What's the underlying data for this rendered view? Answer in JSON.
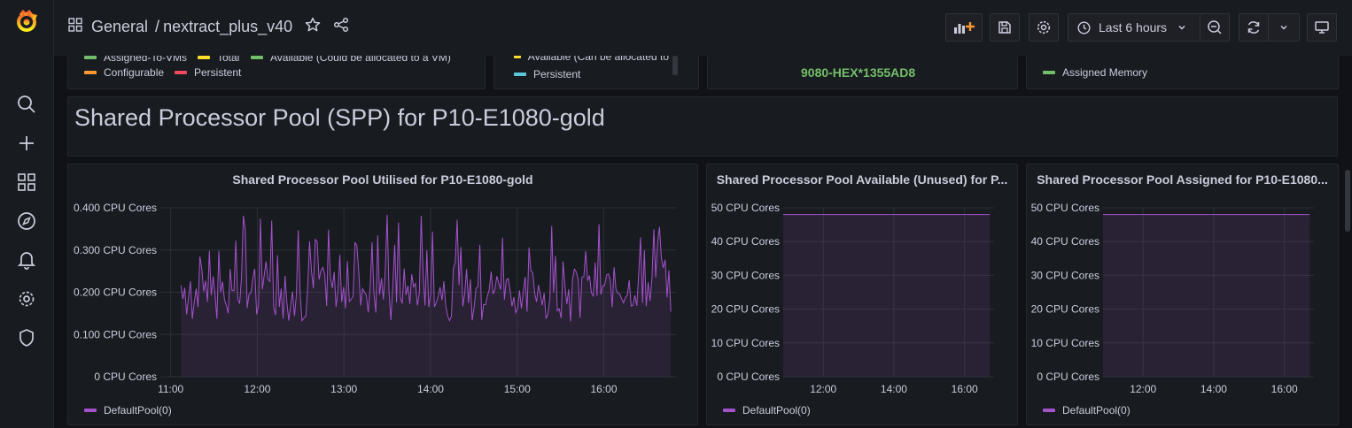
{
  "breadcrumb": {
    "folder": "General",
    "sep": "/",
    "dashboard": "nextract_plus_v40"
  },
  "toolbar": {
    "time_range": "Last 6 hours"
  },
  "top_panels": {
    "p1_legend": [
      {
        "label": "Assigned-To-VMs",
        "color": "#73bf69"
      },
      {
        "label": "Total",
        "color": "#fade2a"
      },
      {
        "label": "Available (Could be allocated to a VM)",
        "color": "#73bf69"
      },
      {
        "label": "Configurable",
        "color": "#ff9830"
      },
      {
        "label": "Persistent",
        "color": "#f2495c"
      }
    ],
    "p2_legend": [
      {
        "label": "Available (Can be allocated to",
        "color": "#fade2a"
      },
      {
        "label": "Persistent",
        "color": "#5ac8d8"
      }
    ],
    "p3_value": "9080-HEX*1355AD8",
    "p4_legend": [
      {
        "label": "Assigned Memory",
        "color": "#73bf69"
      }
    ]
  },
  "row": {
    "title": "Shared Processor Pool (SPP) for P10-E1080-gold"
  },
  "panels": [
    {
      "title": "Shared Processor Pool Utilised for P10-E1080-gold",
      "legend": "DefaultPool(0)",
      "chart_data": {
        "type": "line",
        "series": [
          {
            "name": "DefaultPool(0)",
            "color": "#a352cc"
          }
        ],
        "y_ticks": [
          "0 CPU Cores",
          "0.100 CPU Cores",
          "0.200 CPU Cores",
          "0.300 CPU Cores",
          "0.400 CPU Cores"
        ],
        "x_ticks": [
          "11:00",
          "12:00",
          "13:00",
          "14:00",
          "15:00",
          "16:00"
        ],
        "ylim": [
          0,
          0.4
        ],
        "value_range": [
          0.13,
          0.39
        ],
        "typical_value": 0.21
      }
    },
    {
      "title": "Shared Processor Pool Available (Unused) for P...",
      "legend": "DefaultPool(0)",
      "chart_data": {
        "type": "line",
        "series": [
          {
            "name": "DefaultPool(0)",
            "color": "#a352cc",
            "value": 48
          }
        ],
        "y_ticks": [
          "0 CPU Cores",
          "10 CPU Cores",
          "20 CPU Cores",
          "30 CPU Cores",
          "40 CPU Cores",
          "50 CPU Cores"
        ],
        "x_ticks": [
          "12:00",
          "14:00",
          "16:00"
        ],
        "ylim": [
          0,
          50
        ]
      }
    },
    {
      "title": "Shared Processor Pool Assigned for P10-E1080...",
      "legend": "DefaultPool(0)",
      "chart_data": {
        "type": "line",
        "series": [
          {
            "name": "DefaultPool(0)",
            "color": "#a352cc",
            "value": 48
          }
        ],
        "y_ticks": [
          "0 CPU Cores",
          "10 CPU Cores",
          "20 CPU Cores",
          "30 CPU Cores",
          "40 CPU Cores",
          "50 CPU Cores"
        ],
        "x_ticks": [
          "12:00",
          "14:00",
          "16:00"
        ],
        "ylim": [
          0,
          50
        ]
      }
    }
  ]
}
